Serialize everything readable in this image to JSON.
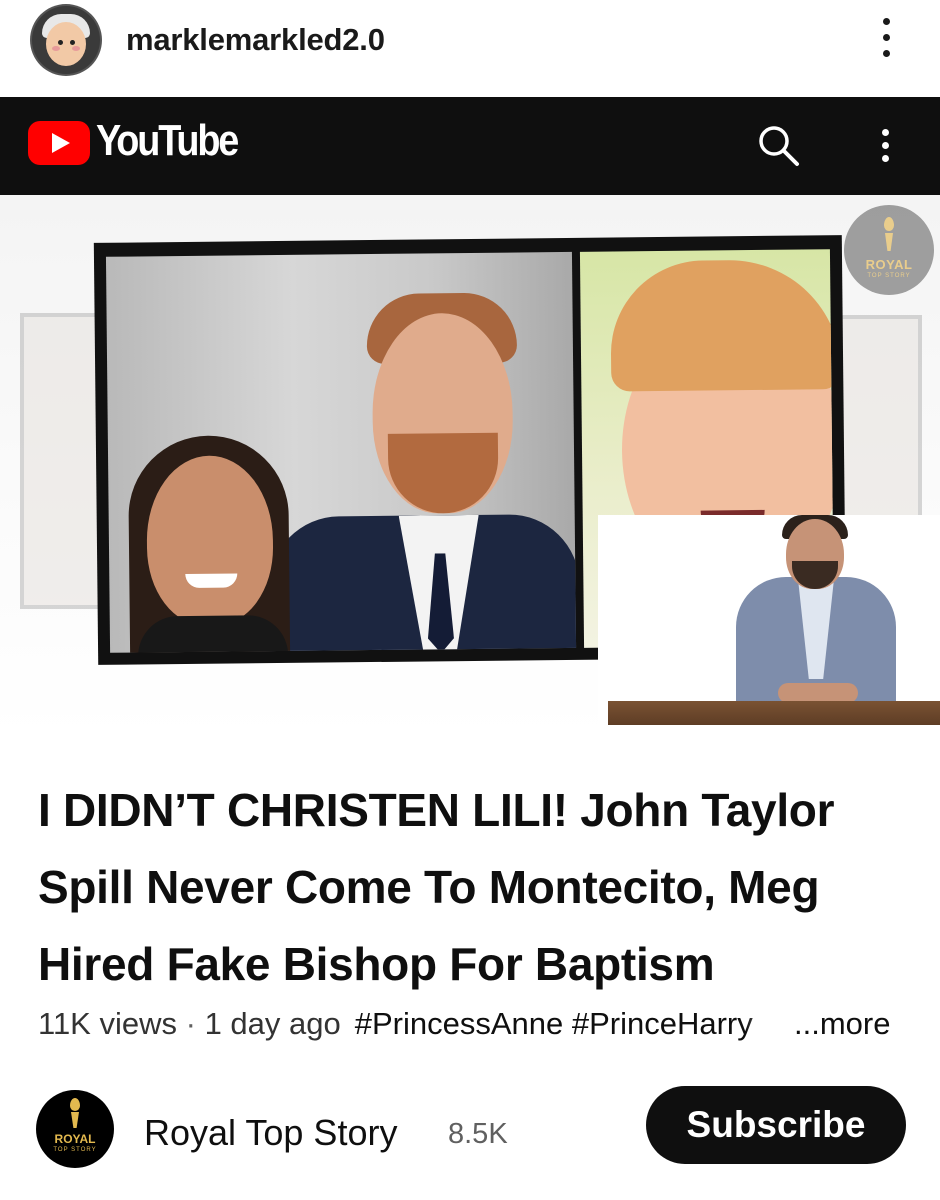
{
  "post": {
    "username": "marklemarkled2.0"
  },
  "youtube": {
    "logo_text": "YouTube"
  },
  "thumbnail": {
    "badge_label": "ROYAL",
    "badge_sub": "TOP STORY"
  },
  "video": {
    "title": "I DIDN’T CHRISTEN LILI! John Taylor Spill Never Come To Montecito, Meg Hired Fake Bishop For Baptism",
    "views": "11K views",
    "separator": " · ",
    "age": "1 day ago",
    "hashtags": "#PrincessAnne #PrinceHarry",
    "more": "...more"
  },
  "channel": {
    "avatar_label": "ROYAL",
    "avatar_sub": "TOP STORY",
    "name": "Royal Top Story",
    "subscribers": "8.5K",
    "subscribe_label": "Subscribe"
  },
  "icons": {
    "post_more": "more-vertical-icon",
    "yt_logo": "youtube-play-icon",
    "search": "search-icon",
    "yt_more": "more-vertical-icon"
  },
  "colors": {
    "youtube_red": "#ff0000",
    "bar_background": "#0f0f0f",
    "subscribe_background": "#0f0f0f",
    "badge_gold": "#e3b94f"
  }
}
